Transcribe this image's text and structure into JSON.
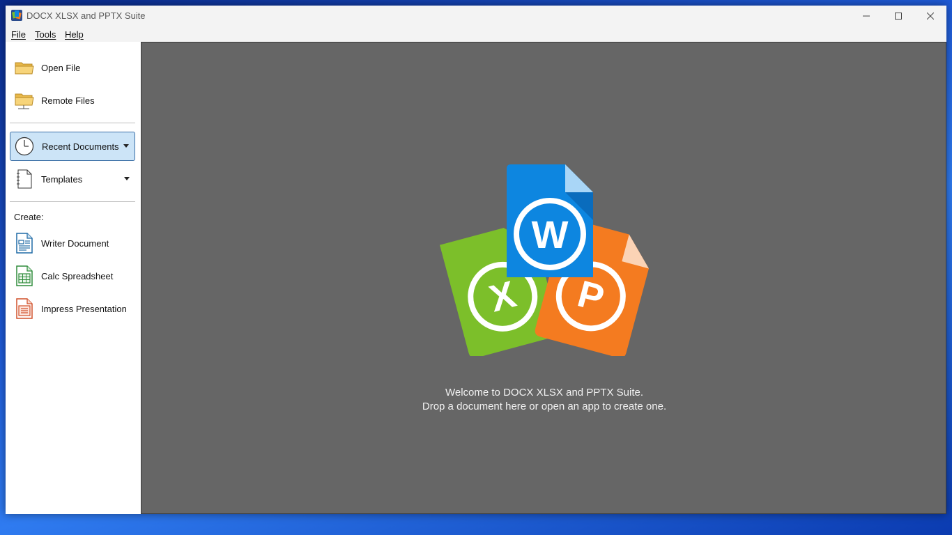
{
  "window": {
    "title": "DOCX XLSX and PPTX Suite"
  },
  "menu": {
    "file": "File",
    "tools": "Tools",
    "help": "Help"
  },
  "sidebar": {
    "open_file": "Open File",
    "remote_files": "Remote Files",
    "recent_documents": "Recent Documents",
    "templates": "Templates",
    "create_label": "Create:",
    "writer": "Writer Document",
    "calc": "Calc Spreadsheet",
    "impress": "Impress Presentation"
  },
  "logo": {
    "w": "W",
    "x": "X",
    "p": "P"
  },
  "welcome": {
    "line1": "Welcome to DOCX XLSX and PPTX Suite.",
    "line2": "Drop a document here or open an app to create one."
  },
  "colors": {
    "blue": "#0d86e0",
    "green": "#7cbf2a",
    "orange": "#f47b20",
    "canvas": "#666666",
    "selected": "#cce4f7"
  }
}
